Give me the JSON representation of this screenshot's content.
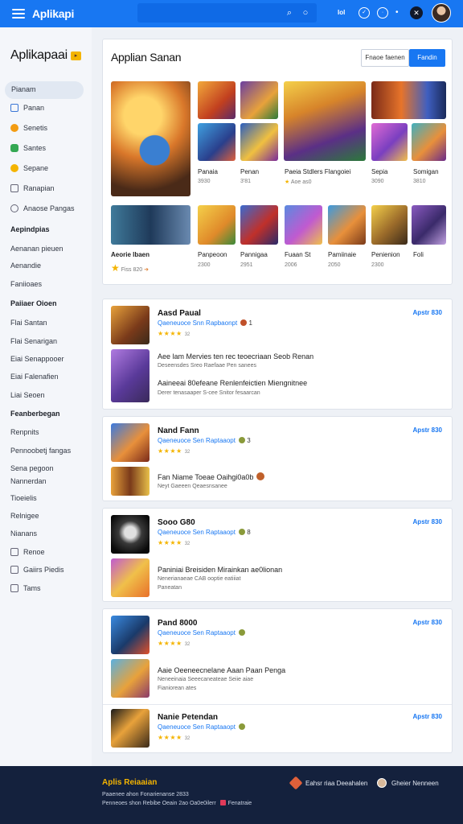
{
  "topbar": {
    "brand": "Aplikapi",
    "search_icon": "search-icon",
    "icons": [
      "lab-icon",
      "check-icon",
      "clock-icon",
      "x-icon",
      "avatar"
    ]
  },
  "sidebar": {
    "title": "Aplikapaai",
    "items": [
      {
        "label": "Pianam",
        "icon": "none"
      },
      {
        "label": "Panan",
        "icon": "image-icon"
      },
      {
        "label": "Senetis",
        "icon": "orange-dot-icon"
      },
      {
        "label": "Santes",
        "icon": "green-dot-icon"
      },
      {
        "label": "Sepane",
        "icon": "yellow-dot-icon"
      },
      {
        "label": "Ranapian",
        "icon": "box-icon"
      },
      {
        "label": "Anaose Pangas",
        "icon": "circle-icon"
      },
      {
        "label": "Aepindpias",
        "icon": "none"
      },
      {
        "label": "Aenanan pieuen",
        "icon": "none"
      },
      {
        "label": "Aenandie",
        "icon": "none"
      },
      {
        "label": "Faniioaes",
        "icon": "none"
      },
      {
        "label": "Paiiaer Oioen",
        "icon": "none"
      },
      {
        "label": "Flai Santan",
        "icon": "none"
      },
      {
        "label": "Flai Senarigan",
        "icon": "none"
      },
      {
        "label": "Eiai Senappooer",
        "icon": "none"
      },
      {
        "label": "Eiai Falenafien",
        "icon": "none"
      },
      {
        "label": "Liai Seoen",
        "icon": "none"
      },
      {
        "label": "Feanberbegan",
        "icon": "none"
      },
      {
        "label": "Renpnits",
        "icon": "none"
      },
      {
        "label": "Pennoobetj fangas",
        "icon": "none"
      },
      {
        "label": "Sena pegoon",
        "icon": "none"
      },
      {
        "label": "Nannerdan",
        "icon": "none"
      },
      {
        "label": "Tioeielis",
        "icon": "none"
      },
      {
        "label": "Relnigee",
        "icon": "none"
      },
      {
        "label": "Nianans",
        "icon": "none"
      },
      {
        "label": "Renoe",
        "icon": "box-icon"
      },
      {
        "label": "Gaiirs Piedis",
        "icon": "box-icon"
      },
      {
        "label": "Tams",
        "icon": "box-icon"
      }
    ]
  },
  "featured": {
    "title": "Applian Sanan",
    "tab_a": "Fnaoe faenen",
    "tab_b": "Fandin",
    "tiles_row1": [
      {
        "label": "Panaia",
        "sub": "3930"
      },
      {
        "label": "Penan",
        "sub": "3'81"
      },
      {
        "label": "Paeia Stdlers Flangoiei",
        "sub": "Aoe as0"
      },
      {
        "label": "Sepia",
        "sub": "3090"
      },
      {
        "label": "Somigan",
        "sub": "3810"
      }
    ],
    "tiles_row2": [
      {
        "label": "Aeorie lbaen",
        "sub": "Fiss 820"
      },
      {
        "label": "Panpeoon",
        "sub": "2300"
      },
      {
        "label": "Pannigaa",
        "sub": "2951"
      },
      {
        "label": "Fuaan St",
        "sub": "2006"
      },
      {
        "label": "Pamiinaie",
        "sub": "2050"
      },
      {
        "label": "Penienion",
        "sub": "2300"
      },
      {
        "label": "Foli",
        "sub": ""
      }
    ]
  },
  "list_cards": [
    {
      "rows": [
        {
          "title": "Aasd Paual",
          "dev": "Qaeneuoce Snn Rapbaonpt",
          "stars": "★★★★",
          "count": "32",
          "price": "Apstr 830",
          "extra": "1"
        },
        {
          "desc": "Aee lam Mervies ten rec teoecriaan Seob Renan",
          "desc2": "Deseensdes Sreo Raefaae Pen sanees"
        },
        {
          "desc": "Aaineeai 80efeane Renlenfeictien Miengnitnee",
          "desc2": "Derer tenasaaper S-cee Snitor fesaarcan"
        }
      ]
    },
    {
      "rows": [
        {
          "title": "Nand Fann",
          "dev": "Qaeneuoce Sen Raptaaopt",
          "stars": "★★★★",
          "count": "32",
          "price": "Apstr 830",
          "extra": "3"
        },
        {
          "desc": "Fan Niame Toeae Oaihgi0a0b",
          "desc2": "Neyt Gaeeen Qeaesnsanee"
        }
      ]
    },
    {
      "rows": [
        {
          "title": "Sooo G80",
          "dev": "Qaeneuoce Sen Raptaaopt",
          "stars": "★★★★",
          "count": "32",
          "price": "Apstr 830",
          "extra": "8"
        },
        {
          "desc": "Paniniai Breisiden Mirainkan ae0lionan",
          "desc2": "Nenerianaeae CAB ooptie eatiiiat",
          "desc3": "Paneatan"
        }
      ]
    },
    {
      "rows": [
        {
          "title": "Pand 8000",
          "dev": "Qaeneuoce Sen Raptaaopt",
          "stars": "★★★★",
          "count": "32",
          "price": "Apstr 830",
          "extra": ""
        },
        {
          "desc": "Aaie Oeeneecnelane Aaan Paan Penga",
          "desc2": "Neneeinaia Seeecaneateae Seiie aiae",
          "desc3": "Fianiorean ates"
        }
      ]
    },
    {
      "rows": [
        {
          "title": "Nanie Petendan",
          "dev": "Qaeneuoce Sen Raptaaopt",
          "stars": "★★★★",
          "count": "32",
          "price": "Apstr 830",
          "extra": ""
        }
      ]
    }
  ],
  "footer": {
    "title": "Aplis Reiaaian",
    "line1": "Paaenee ahon Fonarienanse 2833",
    "line2": "Penneoes shon Rebibe Oeain 2ao Oa0e0ilerr",
    "line2_link": "Fenatraie",
    "link1": "Eahsr riaa Deeahalen",
    "link2": "Gheier Nenneen"
  },
  "colors": {
    "accent": "#1877f2",
    "footer": "#14213d",
    "star": "#f4b400"
  }
}
